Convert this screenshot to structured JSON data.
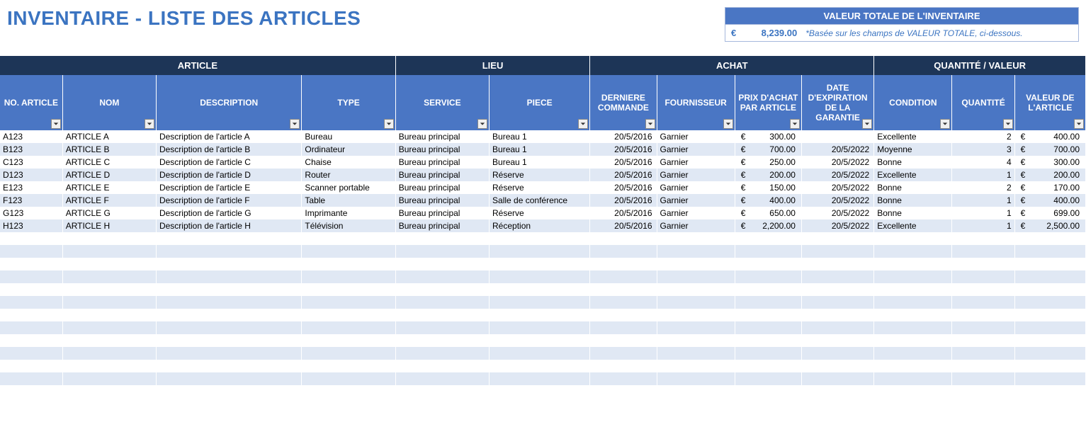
{
  "title": "INVENTAIRE - LISTE DES ARTICLES",
  "summary": {
    "header": "VALEUR TOTALE DE L'INVENTAIRE",
    "currency": "€",
    "amount": "8,239.00",
    "note": "*Basée sur les champs de VALEUR TOTALE, ci-dessous."
  },
  "groups": {
    "article": "ARTICLE",
    "lieu": "LIEU",
    "achat": "ACHAT",
    "quantite": "QUANTITÉ / VALEUR"
  },
  "columns": {
    "no": "NO. ARTICLE",
    "nom": "NOM",
    "desc": "DESCRIPTION",
    "type": "TYPE",
    "service": "SERVICE",
    "piece": "PIECE",
    "last": "DERNIERE COMMANDE",
    "fournisseur": "FOURNISSEUR",
    "prix": "PRIX D'ACHAT PAR ARTICLE",
    "garantie": "DATE D'EXPIRATION DE LA GARANTIE",
    "condition": "CONDITION",
    "qte": "QUANTITÉ",
    "valeur": "VALEUR DE L'ARTICLE"
  },
  "rows": [
    {
      "no": "A123",
      "nom": "ARTICLE A",
      "desc": "Description de l'article A",
      "type": "Bureau",
      "service": "Bureau principal",
      "piece": "Bureau 1",
      "last": "20/5/2016",
      "fournisseur": "Garnier",
      "prix": "300.00",
      "garantie": "",
      "condition": "Excellente",
      "qte": "2",
      "valeur": "400.00"
    },
    {
      "no": "B123",
      "nom": "ARTICLE B",
      "desc": "Description de l'article B",
      "type": "Ordinateur",
      "service": "Bureau principal",
      "piece": "Bureau 1",
      "last": "20/5/2016",
      "fournisseur": "Garnier",
      "prix": "700.00",
      "garantie": "20/5/2022",
      "condition": "Moyenne",
      "qte": "3",
      "valeur": "700.00"
    },
    {
      "no": "C123",
      "nom": "ARTICLE C",
      "desc": "Description de l'article C",
      "type": "Chaise",
      "service": "Bureau principal",
      "piece": "Bureau 1",
      "last": "20/5/2016",
      "fournisseur": "Garnier",
      "prix": "250.00",
      "garantie": "20/5/2022",
      "condition": "Bonne",
      "qte": "4",
      "valeur": "300.00"
    },
    {
      "no": "D123",
      "nom": "ARTICLE D",
      "desc": "Description de l'article D",
      "type": "Router",
      "service": "Bureau principal",
      "piece": "Réserve",
      "last": "20/5/2016",
      "fournisseur": "Garnier",
      "prix": "200.00",
      "garantie": "20/5/2022",
      "condition": "Excellente",
      "qte": "1",
      "valeur": "200.00"
    },
    {
      "no": "E123",
      "nom": "ARTICLE E",
      "desc": "Description de l'article E",
      "type": "Scanner portable",
      "service": "Bureau principal",
      "piece": "Réserve",
      "last": "20/5/2016",
      "fournisseur": "Garnier",
      "prix": "150.00",
      "garantie": "20/5/2022",
      "condition": "Bonne",
      "qte": "2",
      "valeur": "170.00"
    },
    {
      "no": "F123",
      "nom": "ARTICLE F",
      "desc": "Description de l'article F",
      "type": "Table",
      "service": "Bureau principal",
      "piece": "Salle de conférence",
      "last": "20/5/2016",
      "fournisseur": "Garnier",
      "prix": "400.00",
      "garantie": "20/5/2022",
      "condition": "Bonne",
      "qte": "1",
      "valeur": "400.00"
    },
    {
      "no": "G123",
      "nom": "ARTICLE G",
      "desc": "Description de l'article G",
      "type": "Imprimante",
      "service": "Bureau principal",
      "piece": "Réserve",
      "last": "20/5/2016",
      "fournisseur": "Garnier",
      "prix": "650.00",
      "garantie": "20/5/2022",
      "condition": "Bonne",
      "qte": "1",
      "valeur": "699.00"
    },
    {
      "no": "H123",
      "nom": "ARTICLE H",
      "desc": "Description de l'article H",
      "type": "Télévision",
      "service": "Bureau principal",
      "piece": "Réception",
      "last": "20/5/2016",
      "fournisseur": "Garnier",
      "prix": "2,200.00",
      "garantie": "20/5/2022",
      "condition": "Excellente",
      "qte": "1",
      "valeur": "2,500.00"
    }
  ],
  "currency_symbol": "€",
  "empty_rows": 12
}
